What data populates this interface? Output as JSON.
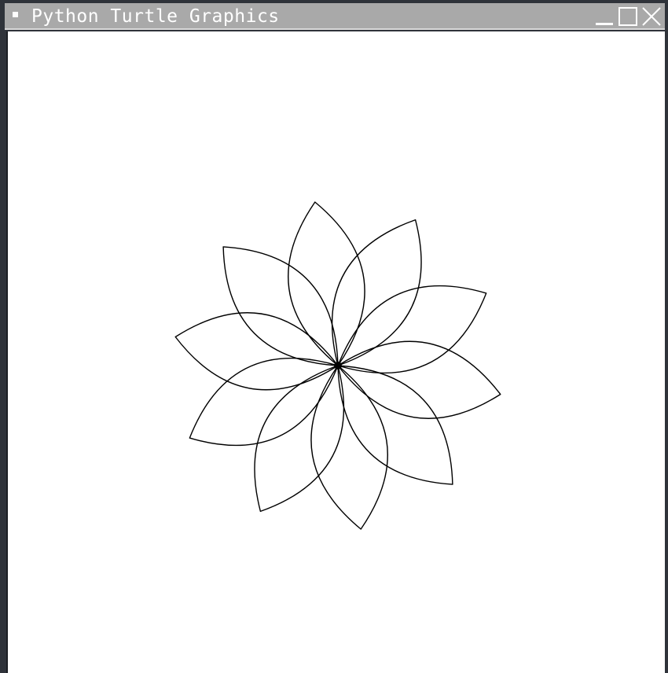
{
  "window": {
    "title": "Python Turtle Graphics",
    "icons": {
      "menu": "window-menu-icon",
      "minimize": "minimize-icon",
      "maximize": "maximize-icon",
      "close": "close-icon"
    }
  },
  "drawing": {
    "petal_count": 10,
    "stroke_color": "#000000",
    "background_color": "#ffffff"
  }
}
